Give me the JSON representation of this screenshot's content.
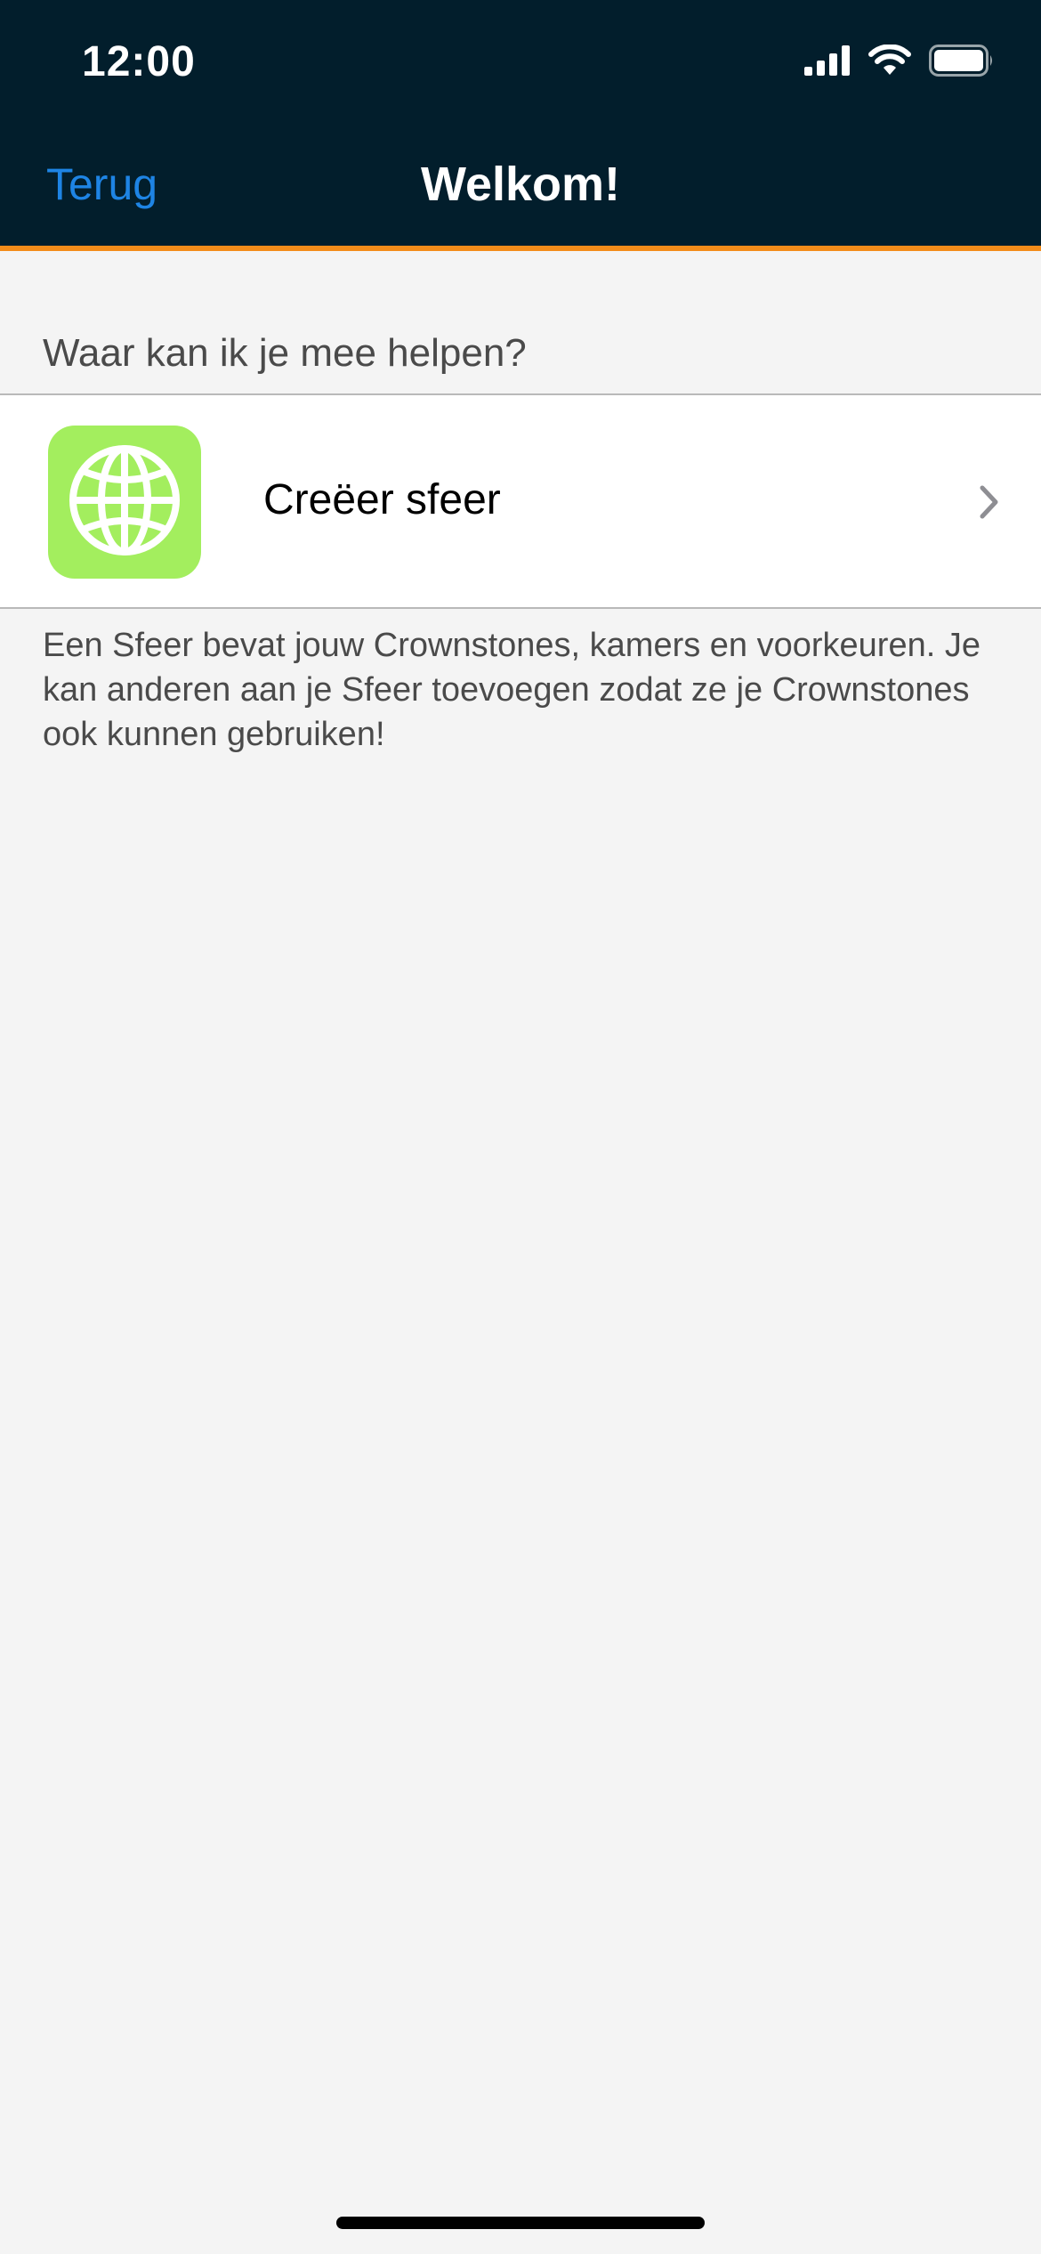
{
  "status_bar": {
    "time": "12:00",
    "icons": [
      "signal-icon",
      "wifi-icon",
      "battery-icon"
    ]
  },
  "nav": {
    "back_label": "Terug",
    "title": "Welkom!"
  },
  "section": {
    "header": "Waar kan ik je mee helpen?",
    "items": [
      {
        "label": "Creëer sfeer",
        "icon": "globe-icon"
      }
    ],
    "footer": "Een Sfeer bevat jouw Crownstones, kamers en voorkeuren. Je kan anderen aan je Sfeer toevoegen zodat ze je Crownstones ook kunnen gebruiken!"
  },
  "colors": {
    "nav_background": "#021e2c",
    "accent_orange": "#f38c1a",
    "link_blue": "#1e84e4",
    "icon_tile_green": "#a3ee5e",
    "page_background": "#f4f4f4"
  }
}
